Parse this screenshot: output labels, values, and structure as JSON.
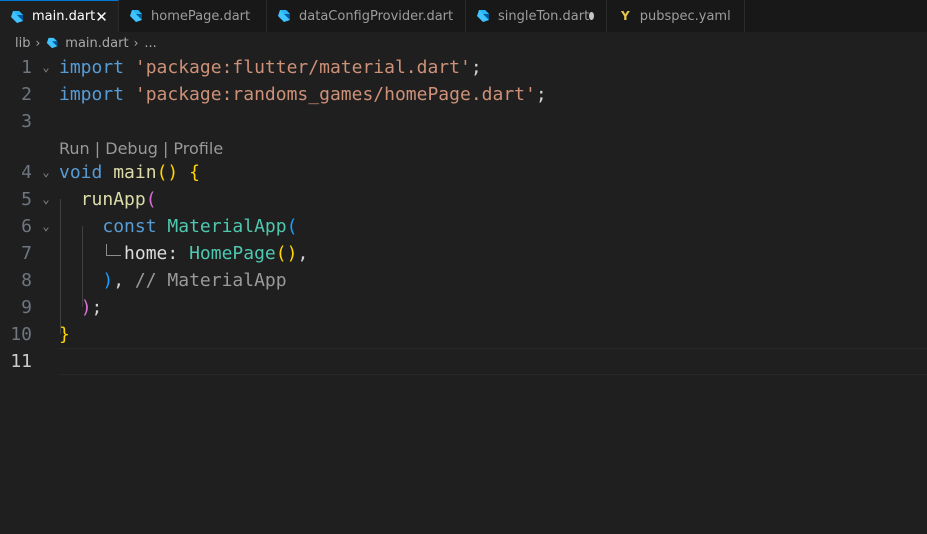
{
  "tabs": [
    {
      "label": "main.dart",
      "icon": "dart-icon",
      "state": "close"
    },
    {
      "label": "homePage.dart",
      "icon": "dart-icon"
    },
    {
      "label": "dataConfigProvider.dart",
      "icon": "dart-icon"
    },
    {
      "label": "singleTon.dart",
      "icon": "dart-icon",
      "state": "modified"
    },
    {
      "label": "pubspec.yaml",
      "icon": "yaml-icon"
    }
  ],
  "tab_close_glyph": "✕",
  "yaml_glyph": "Y",
  "breadcrumb": {
    "folder": "lib",
    "file": "main.dart",
    "more": "..."
  },
  "codelens": "Run | Debug | Profile",
  "fold_glyph": "⌄",
  "lines": {
    "n1": "1",
    "n2": "2",
    "n3": "3",
    "n4": "4",
    "n5": "5",
    "n6": "6",
    "n7": "7",
    "n8": "8",
    "n9": "9",
    "n10": "10",
    "n11": "11"
  },
  "code": {
    "import_kw": "import",
    "import1_str": "'package:flutter/material.dart'",
    "import2_str": "'package:randoms_games/homePage.dart'",
    "semi": ";",
    "void_kw": "void",
    "main_fn": "main",
    "paren_pair": "()",
    "open_brace": "{",
    "close_brace": "}",
    "runapp_fn": "runApp",
    "open_paren": "(",
    "close_paren": ")",
    "const_kw": "const",
    "material_cls": "MaterialApp",
    "home_prop": "home",
    "colon": ":",
    "homepage_cls": "HomePage",
    "comma": ",",
    "comment": "// MaterialApp"
  },
  "colors": {
    "accent": "#0078d4",
    "keyword": "#569cd6",
    "string": "#ce9178",
    "function": "#dcdcaa",
    "class": "#4ec9b0",
    "bracket_gold": "#ffd700",
    "bracket_orchid": "#da70d6",
    "bracket_blue": "#179fff"
  }
}
